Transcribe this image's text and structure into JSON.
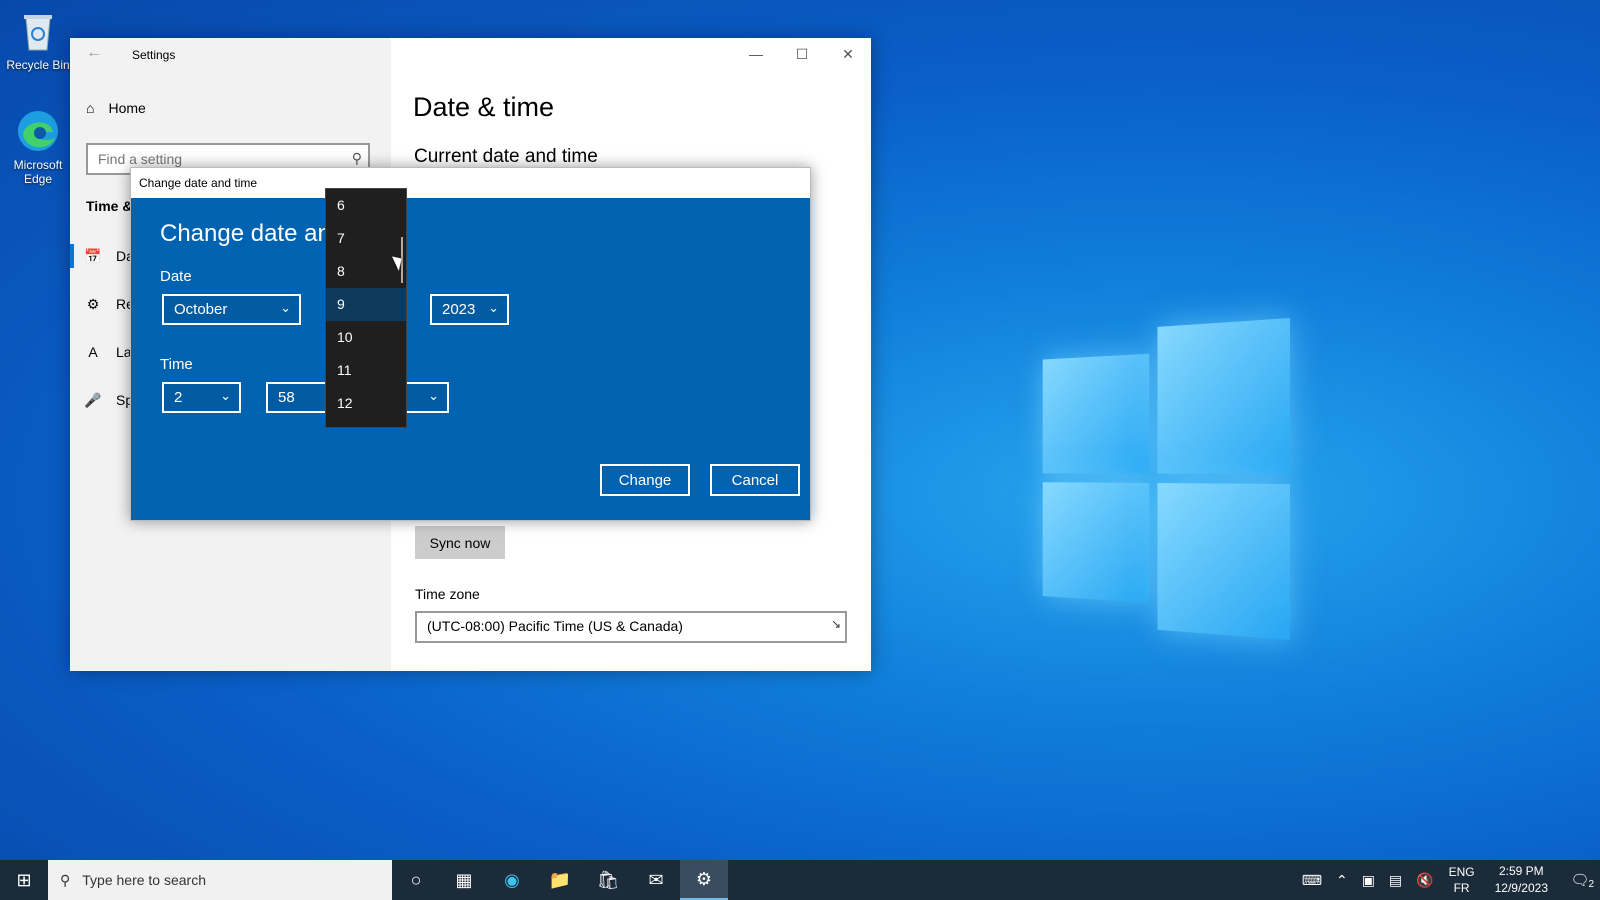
{
  "desktop": {
    "icons": [
      {
        "label": "Recycle Bin",
        "icon": "recycle-bin-icon"
      },
      {
        "label": "Microsoft Edge",
        "icon": "edge-icon"
      }
    ]
  },
  "settings": {
    "title": "Settings",
    "nav": {
      "home": "Home",
      "search_placeholder": "Find a setting",
      "section": "Time &",
      "items": [
        {
          "label": "Da",
          "icon": "calendar-clock-icon"
        },
        {
          "label": "Re",
          "icon": "region-globe-icon"
        },
        {
          "label": "La",
          "icon": "language-icon"
        },
        {
          "label": "Sp",
          "icon": "microphone-icon"
        }
      ]
    },
    "content": {
      "title": "Date & time",
      "subtitle": "Current date and time",
      "sync_button": "Sync now",
      "timezone_label": "Time zone",
      "timezone_value": "(UTC-08:00) Pacific Time (US & Canada)"
    }
  },
  "dialog": {
    "window_title": "Change date and time",
    "heading": "Change date and",
    "date_label": "Date",
    "month": "October",
    "year": "2023",
    "time_label": "Time",
    "hour": "2",
    "minute": "58",
    "change_button": "Change",
    "cancel_button": "Cancel"
  },
  "day_dropdown": {
    "options": [
      "6",
      "7",
      "8",
      "9",
      "10",
      "11",
      "12"
    ],
    "selected": "9"
  },
  "taskbar": {
    "search_placeholder": "Type here to search",
    "lang_top": "ENG",
    "lang_bottom": "FR",
    "time": "2:59 PM",
    "date": "12/9/2023",
    "notification_count": "2"
  }
}
